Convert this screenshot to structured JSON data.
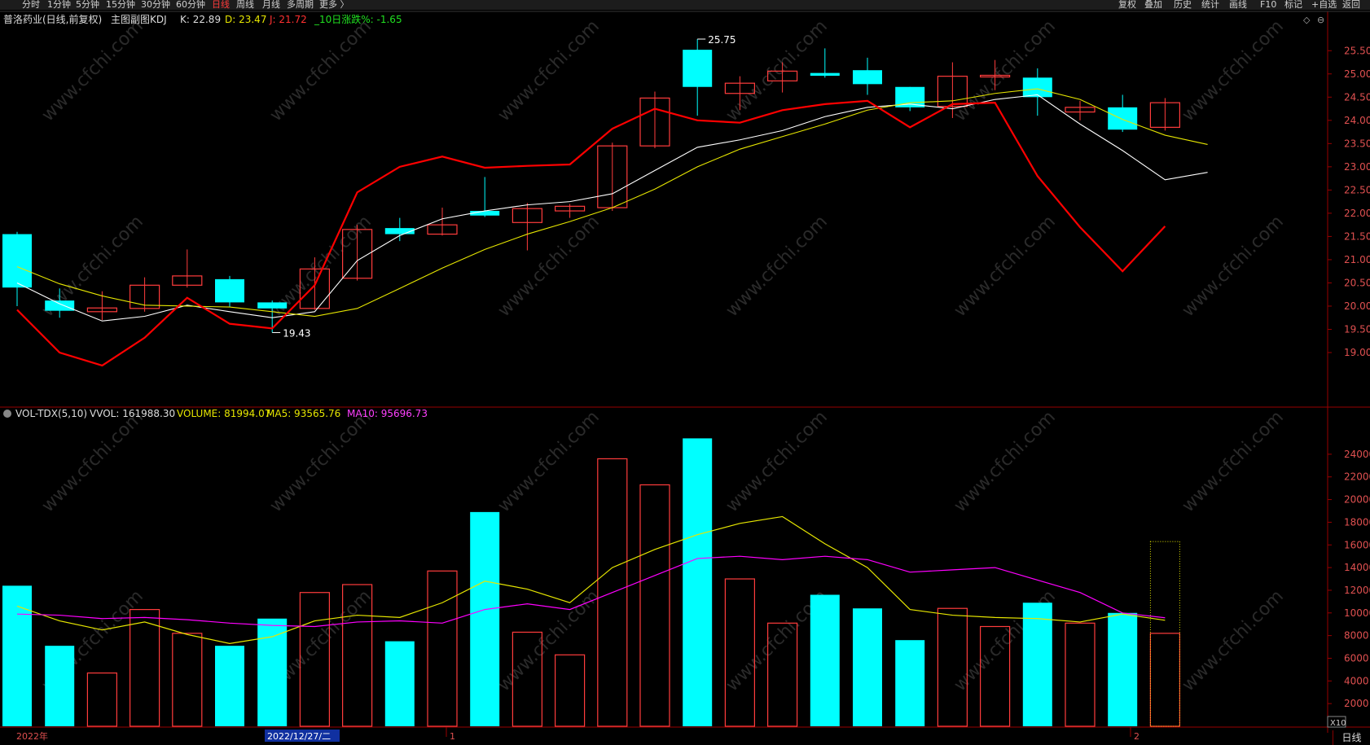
{
  "toolbar": {
    "left": [
      "分时",
      "1分钟",
      "5分钟",
      "15分钟",
      "30分钟",
      "60分钟",
      "日线",
      "周线",
      "月线",
      "多周期",
      "更多 〉"
    ],
    "active": "日线",
    "right": [
      "复权",
      "叠加",
      "历史",
      "统计",
      "画线",
      "F10",
      "标记",
      "+自选",
      "返回"
    ]
  },
  "main_header": {
    "stock": "普洛药业(日线,前复权)",
    "indicator": "主图副图KDJ",
    "k": "K: 22.89",
    "d": "D: 23.47",
    "j": "J: 21.72",
    "chg": "_10日涨跌%: -1.65"
  },
  "vol_header": {
    "name": "VOL-TDX(5,10)",
    "vvol": "VVOL: 161988.30",
    "volume": "VOLUME: 81994.07",
    "ma5": "MA5: 93565.76",
    "ma10": "MA10: 95696.73"
  },
  "annotations": {
    "high": "25.75",
    "low": "19.43"
  },
  "price_axis": [
    "25.50",
    "25.00",
    "24.50",
    "24.00",
    "23.50",
    "23.00",
    "22.50",
    "22.00",
    "21.50",
    "21.00",
    "20.50",
    "20.00",
    "19.50",
    "19.00"
  ],
  "volume_axis": [
    "24000",
    "22000",
    "20000",
    "18000",
    "16000",
    "14000",
    "12000",
    "10000",
    "8000",
    "6000",
    "4000",
    "2000"
  ],
  "time_axis": [
    "2022年",
    "2022/12/27/二",
    "1",
    "2"
  ],
  "zoom_label": "X10",
  "period_label": "日线",
  "watermark": "www.cfchi.com",
  "colors": {
    "up": "#ff3c3c",
    "down": "#00ffff",
    "ma_white": "#ffffff",
    "ma_yellow": "#e6e600",
    "j_line": "#ff0000",
    "ma10": "#ff00ff",
    "grid": "#990000"
  },
  "chart_data": [
    {
      "type": "candlestick",
      "title": "普洛药业(日线,前复权)",
      "ylim": [
        18.7,
        25.8
      ],
      "candles": [
        {
          "o": 21.55,
          "h": 21.6,
          "l": 20.0,
          "c": 20.4
        },
        {
          "o": 20.12,
          "h": 20.38,
          "l": 19.75,
          "c": 19.9
        },
        {
          "o": 19.88,
          "h": 20.32,
          "l": 19.7,
          "c": 19.96
        },
        {
          "o": 19.95,
          "h": 20.62,
          "l": 19.88,
          "c": 20.45
        },
        {
          "o": 20.45,
          "h": 21.22,
          "l": 20.4,
          "c": 20.65
        },
        {
          "o": 20.58,
          "h": 20.65,
          "l": 19.98,
          "c": 20.08
        },
        {
          "o": 20.08,
          "h": 20.12,
          "l": 19.43,
          "c": 19.95
        },
        {
          "o": 19.95,
          "h": 21.05,
          "l": 19.92,
          "c": 20.8
        },
        {
          "o": 20.6,
          "h": 21.75,
          "l": 20.55,
          "c": 21.65
        },
        {
          "o": 21.68,
          "h": 21.9,
          "l": 21.4,
          "c": 21.55
        },
        {
          "o": 21.55,
          "h": 22.12,
          "l": 21.52,
          "c": 21.75
        },
        {
          "o": 22.05,
          "h": 22.78,
          "l": 21.92,
          "c": 21.95
        },
        {
          "o": 21.8,
          "h": 22.22,
          "l": 21.2,
          "c": 22.1
        },
        {
          "o": 22.05,
          "h": 22.2,
          "l": 21.9,
          "c": 22.15
        },
        {
          "o": 22.12,
          "h": 23.52,
          "l": 22.05,
          "c": 23.45
        },
        {
          "o": 23.45,
          "h": 24.62,
          "l": 23.4,
          "c": 24.48
        },
        {
          "o": 25.52,
          "h": 25.75,
          "l": 24.1,
          "c": 24.72
        },
        {
          "o": 24.58,
          "h": 24.95,
          "l": 24.22,
          "c": 24.8
        },
        {
          "o": 24.85,
          "h": 25.25,
          "l": 24.6,
          "c": 25.06
        },
        {
          "o": 25.02,
          "h": 25.55,
          "l": 24.92,
          "c": 24.96
        },
        {
          "o": 25.08,
          "h": 25.35,
          "l": 24.55,
          "c": 24.78
        },
        {
          "o": 24.72,
          "h": 24.72,
          "l": 24.2,
          "c": 24.28
        },
        {
          "o": 24.3,
          "h": 25.25,
          "l": 24.05,
          "c": 24.95
        },
        {
          "o": 24.97,
          "h": 25.3,
          "l": 24.65,
          "c": 24.97
        },
        {
          "o": 24.92,
          "h": 25.12,
          "l": 24.1,
          "c": 24.5
        },
        {
          "o": 24.18,
          "h": 24.42,
          "l": 24.0,
          "c": 24.28
        },
        {
          "o": 24.28,
          "h": 24.55,
          "l": 23.75,
          "c": 23.8
        },
        {
          "o": 23.85,
          "h": 24.48,
          "l": 23.78,
          "c": 24.38
        }
      ],
      "series": [
        {
          "color": "#ffffff",
          "values": [
            20.5,
            20.05,
            19.68,
            19.78,
            20.02,
            19.88,
            19.75,
            19.88,
            20.98,
            21.52,
            21.88,
            22.05,
            22.18,
            22.25,
            22.42,
            22.92,
            23.42,
            23.58,
            23.78,
            24.08,
            24.28,
            24.35,
            24.25,
            24.45,
            24.55,
            23.92,
            23.35,
            22.72,
            22.88
          ]
        },
        {
          "color": "#e6e600",
          "values": [
            20.85,
            20.48,
            20.22,
            20.02,
            20.0,
            19.98,
            19.88,
            19.78,
            19.95,
            20.38,
            20.82,
            21.22,
            21.55,
            21.82,
            22.12,
            22.52,
            23.0,
            23.38,
            23.65,
            23.92,
            24.22,
            24.38,
            24.42,
            24.58,
            24.68,
            24.45,
            24.02,
            23.68,
            23.48
          ]
        },
        {
          "color": "#ff0000",
          "values": [
            19.92,
            19.0,
            18.72,
            19.32,
            20.18,
            19.62,
            19.52,
            20.45,
            22.45,
            23.0,
            23.22,
            22.98,
            23.02,
            23.05,
            23.82,
            24.25,
            24.0,
            23.95,
            24.22,
            24.35,
            24.42,
            23.85,
            24.35,
            24.38,
            22.8,
            21.7,
            20.75,
            21.72
          ]
        }
      ]
    },
    {
      "type": "bar",
      "title": "VOL-TDX(5,10)",
      "ylim": [
        0,
        25500
      ],
      "bars": [
        {
          "v": 12400,
          "up": false
        },
        {
          "v": 7100,
          "up": false
        },
        {
          "v": 4700,
          "up": true
        },
        {
          "v": 10300,
          "up": true
        },
        {
          "v": 8200,
          "up": true
        },
        {
          "v": 7100,
          "up": false
        },
        {
          "v": 9500,
          "up": false
        },
        {
          "v": 11800,
          "up": true
        },
        {
          "v": 12500,
          "up": true
        },
        {
          "v": 7500,
          "up": false
        },
        {
          "v": 13700,
          "up": true
        },
        {
          "v": 18900,
          "up": false
        },
        {
          "v": 8300,
          "up": true
        },
        {
          "v": 6300,
          "up": true
        },
        {
          "v": 23600,
          "up": true
        },
        {
          "v": 21300,
          "up": true
        },
        {
          "v": 25400,
          "up": false
        },
        {
          "v": 13000,
          "up": true
        },
        {
          "v": 9100,
          "up": true
        },
        {
          "v": 11600,
          "up": false
        },
        {
          "v": 10400,
          "up": false
        },
        {
          "v": 7600,
          "up": false
        },
        {
          "v": 10400,
          "up": true
        },
        {
          "v": 8800,
          "up": true
        },
        {
          "v": 10900,
          "up": false
        },
        {
          "v": 9100,
          "up": true
        },
        {
          "v": 10000,
          "up": false
        },
        {
          "v": 8200,
          "up": true
        }
      ],
      "ghost_bar": 16300,
      "series": [
        {
          "name": "MA5",
          "color": "#e6e600",
          "values": [
            10600,
            9300,
            8500,
            9200,
            8100,
            7300,
            7900,
            9300,
            9800,
            9600,
            10900,
            12800,
            12100,
            10900,
            14000,
            15600,
            16900,
            17900,
            18500,
            16100,
            14000,
            10300,
            9800,
            9600,
            9500,
            9200,
            9900,
            9350
          ]
        },
        {
          "name": "MA10",
          "color": "#ff00ff",
          "values": [
            9900,
            9800,
            9500,
            9600,
            9400,
            9100,
            8900,
            8800,
            9200,
            9300,
            9100,
            10300,
            10800,
            10300,
            11800,
            13300,
            14800,
            15000,
            14700,
            15000,
            14700,
            13600,
            13800,
            14000,
            12900,
            11800,
            10000,
            9570
          ]
        }
      ]
    }
  ]
}
